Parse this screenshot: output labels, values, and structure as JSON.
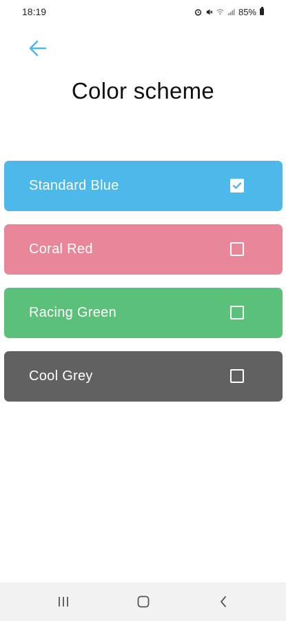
{
  "status_bar": {
    "time": "18:19",
    "battery": "85%",
    "icons": [
      "alarm-icon",
      "mute-icon",
      "wifi-icon",
      "signal-icon",
      "battery-icon"
    ]
  },
  "header": {
    "back_icon": "arrow-left-icon",
    "title": "Color scheme"
  },
  "options": [
    {
      "label": "Standard Blue",
      "color": "#4db8ea",
      "checked": true
    },
    {
      "label": "Coral Red",
      "color": "#e8879a",
      "checked": false
    },
    {
      "label": "Racing Green",
      "color": "#5ac07a",
      "checked": false
    },
    {
      "label": "Cool Grey",
      "color": "#616161",
      "checked": false
    }
  ],
  "nav_bar": {
    "icons": [
      "recent-apps-icon",
      "home-icon",
      "back-nav-icon"
    ]
  },
  "colors": {
    "accent": "#4db8ea"
  }
}
